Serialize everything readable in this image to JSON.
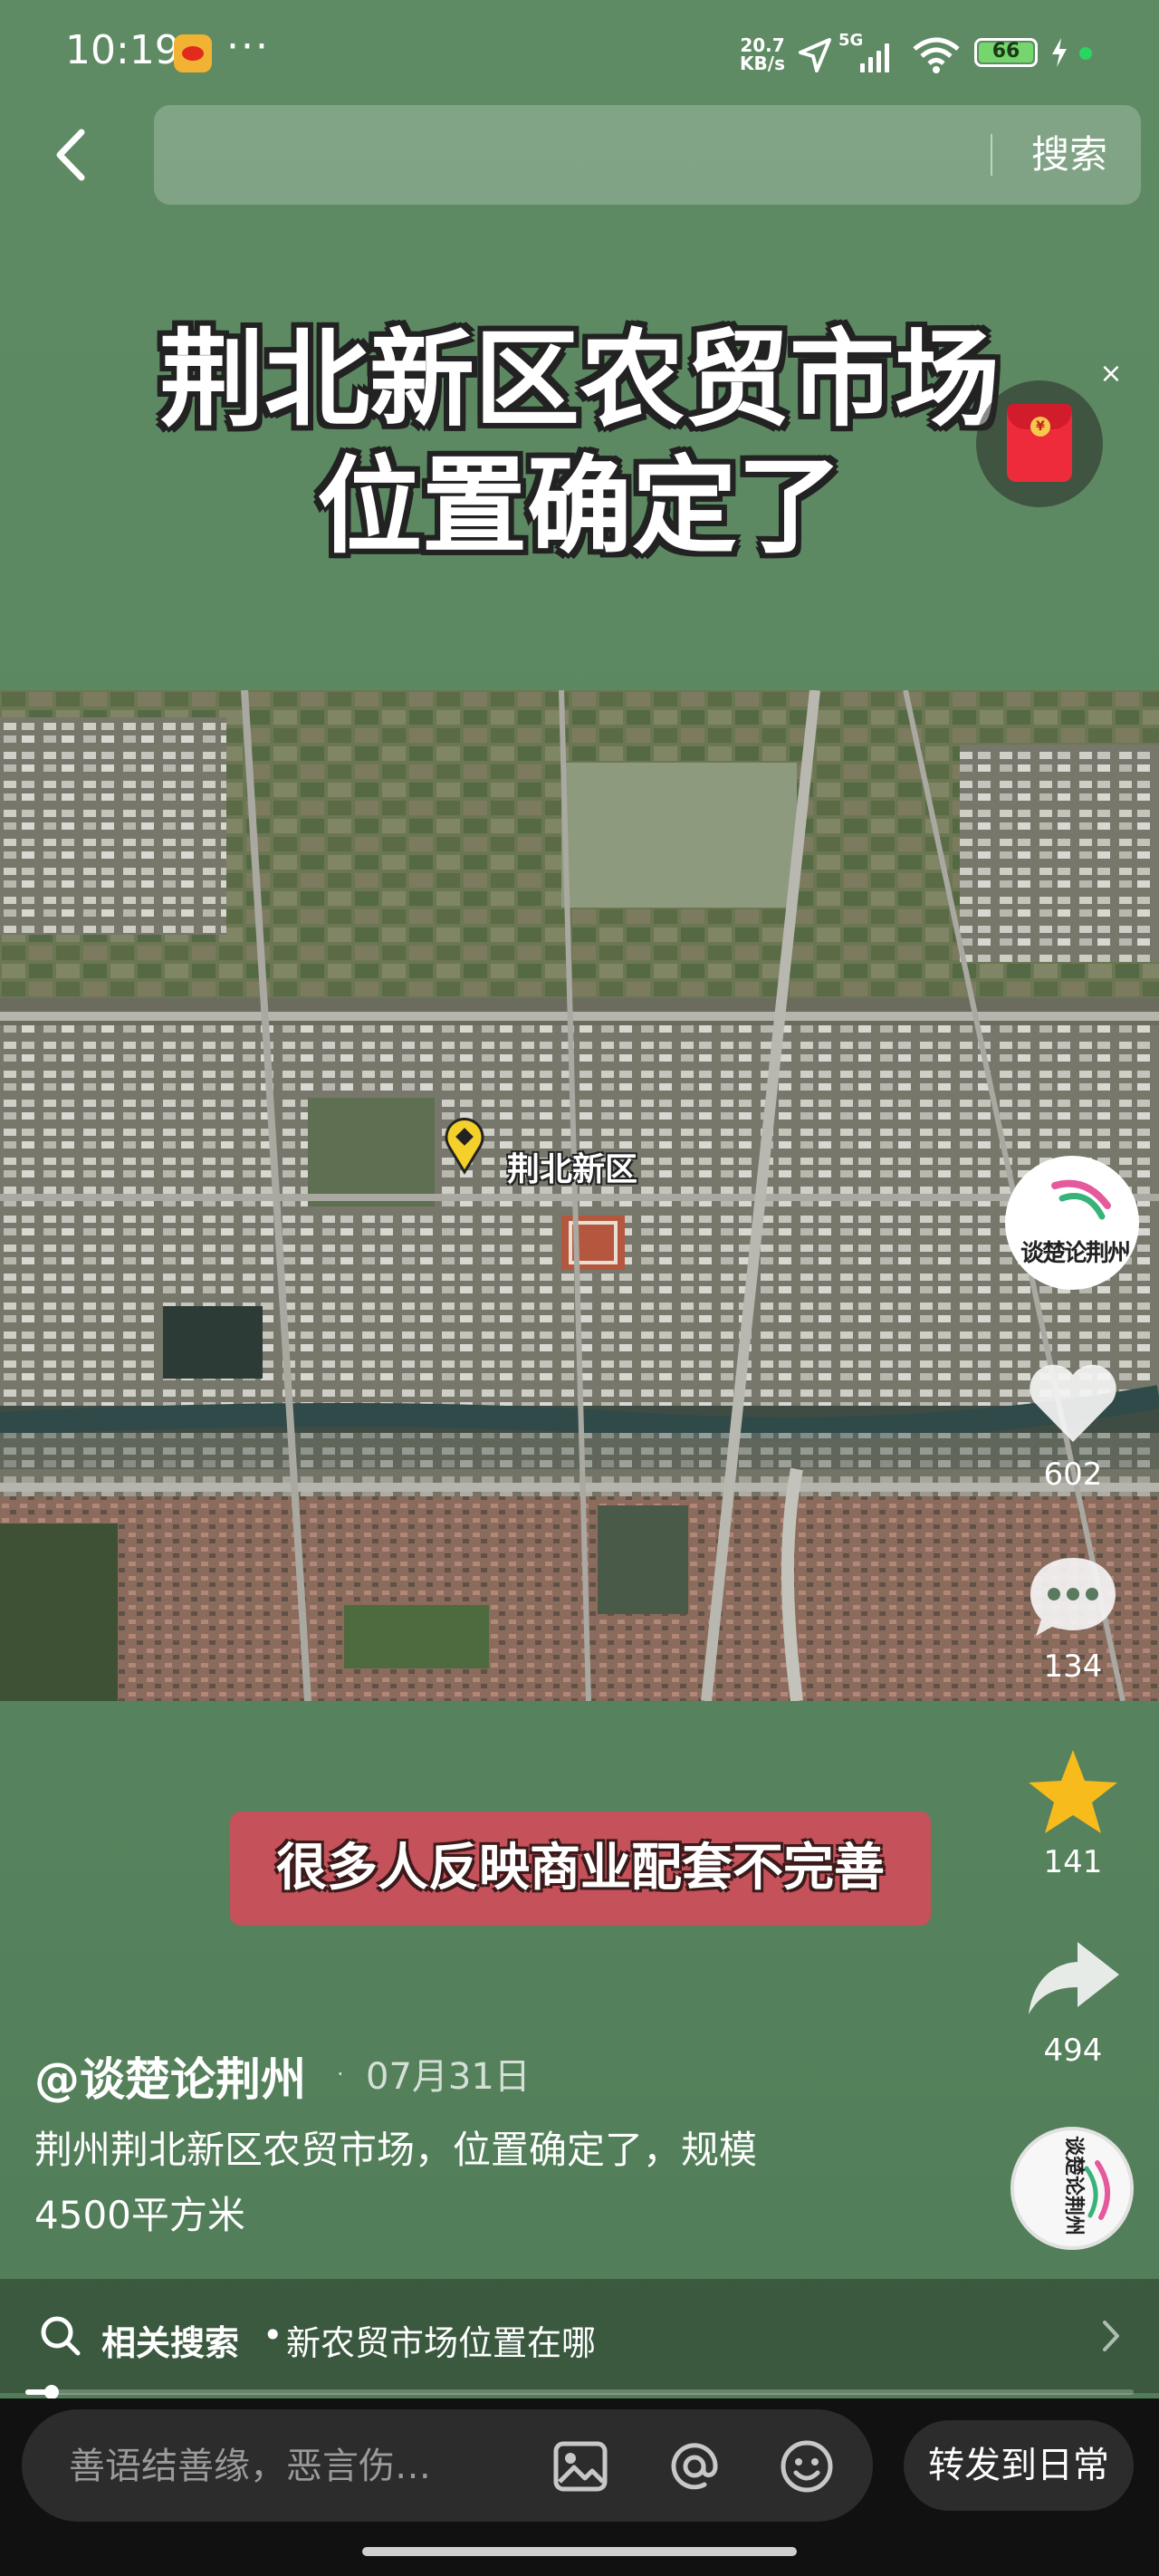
{
  "status_bar": {
    "time": "10:19",
    "more": "···",
    "net_speed": "20.7\nKB/s",
    "signal_label": "5G",
    "battery": "66"
  },
  "search": {
    "placeholder": "",
    "button": "搜索"
  },
  "video": {
    "title_line1": "荆北新区农贸市场",
    "title_line2": "位置确定了",
    "map_pin_label": "荆北新区",
    "caption": "很多人反映商业配套不完善",
    "progress": 0.024
  },
  "actions": {
    "avatar_text": "谈楚论荆州",
    "likes": "602",
    "comments": "134",
    "favorites": "141",
    "shares": "494",
    "music_text": "谈楚论荆州"
  },
  "post": {
    "author": "@谈楚论荆州",
    "dot": "·",
    "date": "07月31日",
    "description": "荆州荆北新区农贸市场，位置确定了，规模4500平方米"
  },
  "related": {
    "label": "相关搜索",
    "separator": "•",
    "query": "新农贸市场位置在哪"
  },
  "comment_bar": {
    "placeholder": "善语结善缘，恶言伤…",
    "repost": "转发到日常"
  },
  "colors": {
    "background": "#5d8a63",
    "caption_banner": "#c5515a",
    "star": "#f7bb1c",
    "battery": "#74d66d"
  },
  "icons": [
    "back-arrow-icon",
    "heart-icon",
    "comment-icon",
    "star-icon",
    "share-icon",
    "search-icon",
    "chevron-right-icon",
    "image-icon",
    "at-icon",
    "emoji-icon",
    "red-packet-icon",
    "map-pin-icon"
  ]
}
